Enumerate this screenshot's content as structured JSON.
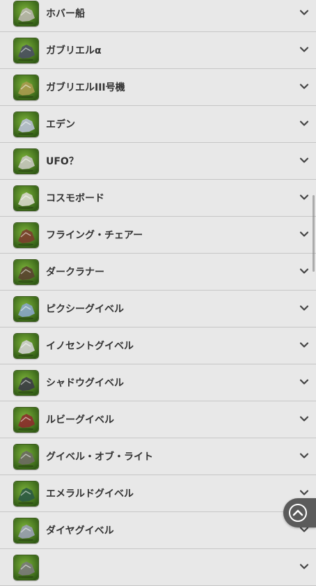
{
  "items": [
    {
      "label": "ホバー船",
      "icon": "hover-ship-icon",
      "art": "#b9b6ad"
    },
    {
      "label": "ガブリエルα",
      "icon": "gabriel-alpha-icon",
      "art": "#4a4f60"
    },
    {
      "label": "ガブリエルIII号機",
      "icon": "gabriel-iii-icon",
      "art": "#a89a4e"
    },
    {
      "label": "エデン",
      "icon": "eden-icon",
      "art": "#b8bfd4"
    },
    {
      "label": "UFO？",
      "icon": "ufo-icon",
      "art": "#c8c8c0"
    },
    {
      "label": "コスモボード",
      "icon": "cosmo-board-icon",
      "art": "#d8d8cc"
    },
    {
      "label": "フライング・チェアー",
      "icon": "flying-chair-icon",
      "art": "#7a3d2c"
    },
    {
      "label": "ダークラナー",
      "icon": "dark-runner-icon",
      "art": "#5a4230"
    },
    {
      "label": "ピクシーグイベル",
      "icon": "pixie-gyibel-icon",
      "art": "#8aa6c8"
    },
    {
      "label": "イノセントグイベル",
      "icon": "innocent-gyibel-icon",
      "art": "#d0d0d0"
    },
    {
      "label": "シャドウグイベル",
      "icon": "shadow-gyibel-icon",
      "art": "#3c3c46"
    },
    {
      "label": "ルビーグイベル",
      "icon": "ruby-gyibel-icon",
      "art": "#8c2c2c"
    },
    {
      "label": "グイベル・オブ・ライト",
      "icon": "gyibel-of-light-icon",
      "art": "#6c6a62"
    },
    {
      "label": "エメラルドグイベル",
      "icon": "emerald-gyibel-icon",
      "art": "#2c5a44"
    },
    {
      "label": "ダイヤグイベル",
      "icon": "diamond-gyibel-icon",
      "art": "#9aa0b4"
    },
    {
      "label": "",
      "icon": "mount-icon",
      "art": "#7a7a7a"
    }
  ],
  "colors": {
    "thumb_bg_light": "#7db33a",
    "thumb_bg_dark": "#2f5a14",
    "row_bg": "#e8e8e8",
    "divider": "#c6c6c6",
    "label": "#333333",
    "chevron": "#444444",
    "scroll_top_bg": "#5b5b5b"
  },
  "scroll_top": {
    "icon": "chevron-up-icon"
  }
}
